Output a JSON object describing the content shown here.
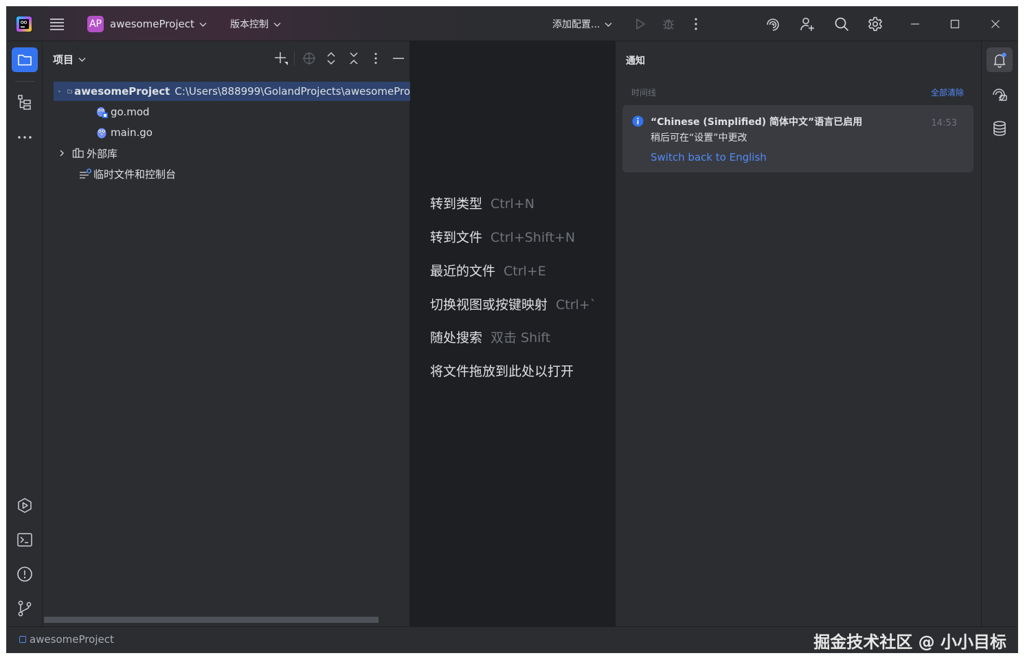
{
  "titlebar": {
    "project_badge": "AP",
    "project_name": "awesomeProject",
    "vcs_menu": "版本控制",
    "add_config": "添加配置..."
  },
  "project_panel": {
    "title": "项目",
    "tree": {
      "root_name": "awesomeProject",
      "root_path": "C:\\Users\\888999\\GolandProjects\\awesomePro",
      "file_1": "go.mod",
      "file_2": "main.go",
      "external_libs": "外部库",
      "scratches": "临时文件和控制台"
    }
  },
  "editor": {
    "hints": [
      {
        "label": "转到类型",
        "keys": "Ctrl+N"
      },
      {
        "label": "转到文件",
        "keys": "Ctrl+Shift+N"
      },
      {
        "label": "最近的文件",
        "keys": "Ctrl+E"
      },
      {
        "label": "切换视图或按键映射",
        "keys": "Ctrl+`"
      },
      {
        "label": "随处搜索",
        "keys": "双击 Shift"
      },
      {
        "label": "将文件拖放到此处以打开",
        "keys": ""
      }
    ]
  },
  "notifications": {
    "title": "通知",
    "timeline_label": "时间线",
    "clear_all": "全部清除",
    "card": {
      "heading": "“Chinese (Simplified) 简体中文”语言已启用",
      "subtext": "稍后可在“设置”中更改",
      "link": "Switch back to English",
      "time": "14:53"
    }
  },
  "statusbar": {
    "breadcrumb": "awesomeProject"
  },
  "watermark": "掘金技术社区 @ 小小目标",
  "colors": {
    "accent": "#3574f0",
    "link": "#548af7",
    "selection": "#2e436e",
    "panel_bg": "#2b2d30",
    "editor_bg": "#1e1f22"
  },
  "icons": [
    "goland-logo",
    "hamburger-menu-icon",
    "run-icon",
    "debug-icon",
    "more-vertical-icon",
    "ai-assistant-icon",
    "add-user-icon",
    "search-icon",
    "gear-icon",
    "minimize-icon",
    "maximize-icon",
    "close-icon",
    "folder-icon",
    "structure-icon",
    "more-horizontal-icon",
    "services-icon",
    "terminal-icon",
    "problems-icon",
    "git-icon",
    "bell-icon",
    "ai-chat-icon",
    "database-icon"
  ]
}
